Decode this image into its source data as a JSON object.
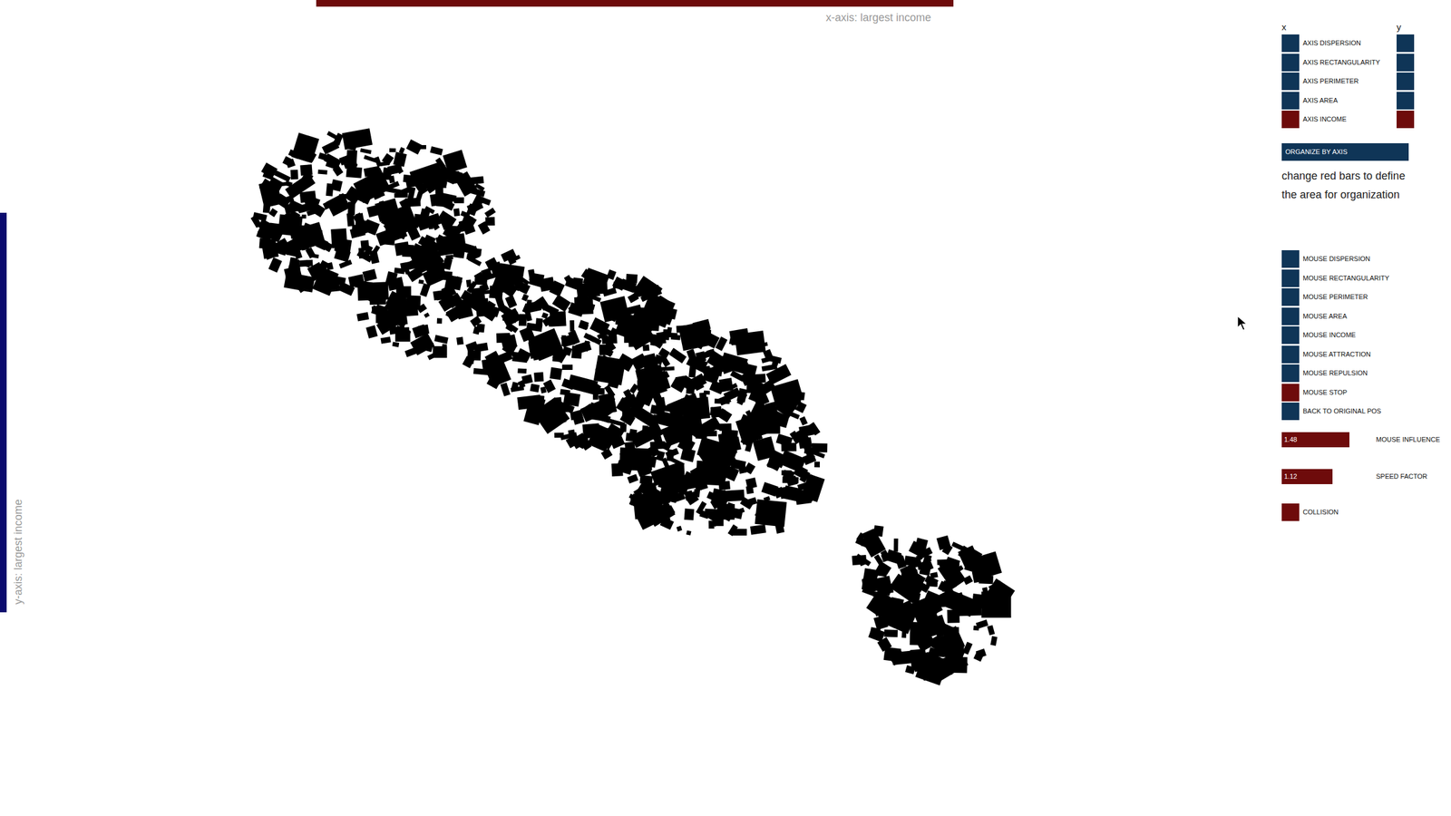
{
  "x_axis": {
    "label": "x-axis: largest income"
  },
  "y_axis": {
    "label": "y-axis: largest income"
  },
  "axis_panel": {
    "x_header": "x",
    "y_header": "y",
    "options": [
      {
        "label": "AXIS DISPERSION",
        "x_selected": false,
        "y_selected": false
      },
      {
        "label": "AXIS RECTANGULARITY",
        "x_selected": false,
        "y_selected": false
      },
      {
        "label": "AXIS PERIMETER",
        "x_selected": false,
        "y_selected": false
      },
      {
        "label": "AXIS AREA",
        "x_selected": false,
        "y_selected": false
      },
      {
        "label": "AXIS INCOME",
        "x_selected": true,
        "y_selected": true
      }
    ]
  },
  "organize_button": "ORGANIZE BY AXIS",
  "hint": "change red bars to define the area for organization",
  "mouse_options": [
    {
      "label": "MOUSE DISPERSION",
      "selected": false
    },
    {
      "label": "MOUSE RECTANGULARITY",
      "selected": false
    },
    {
      "label": "MOUSE PERIMETER",
      "selected": false
    },
    {
      "label": "MOUSE AREA",
      "selected": false
    },
    {
      "label": "MOUSE INCOME",
      "selected": false
    },
    {
      "label": "MOUSE ATTRACTION",
      "selected": false
    },
    {
      "label": "MOUSE REPULSION",
      "selected": false
    },
    {
      "label": "MOUSE STOP",
      "selected": true
    },
    {
      "label": "BACK TO ORIGINAL POS",
      "selected": false
    }
  ],
  "sliders": [
    {
      "label": "MOUSE INFLUENCE",
      "reading": "1.48",
      "level": 0.8
    },
    {
      "label": "SPEED FACTOR",
      "reading": "1.12",
      "level": 0.6
    }
  ],
  "collision": {
    "label": "COLLISION",
    "on": true
  }
}
